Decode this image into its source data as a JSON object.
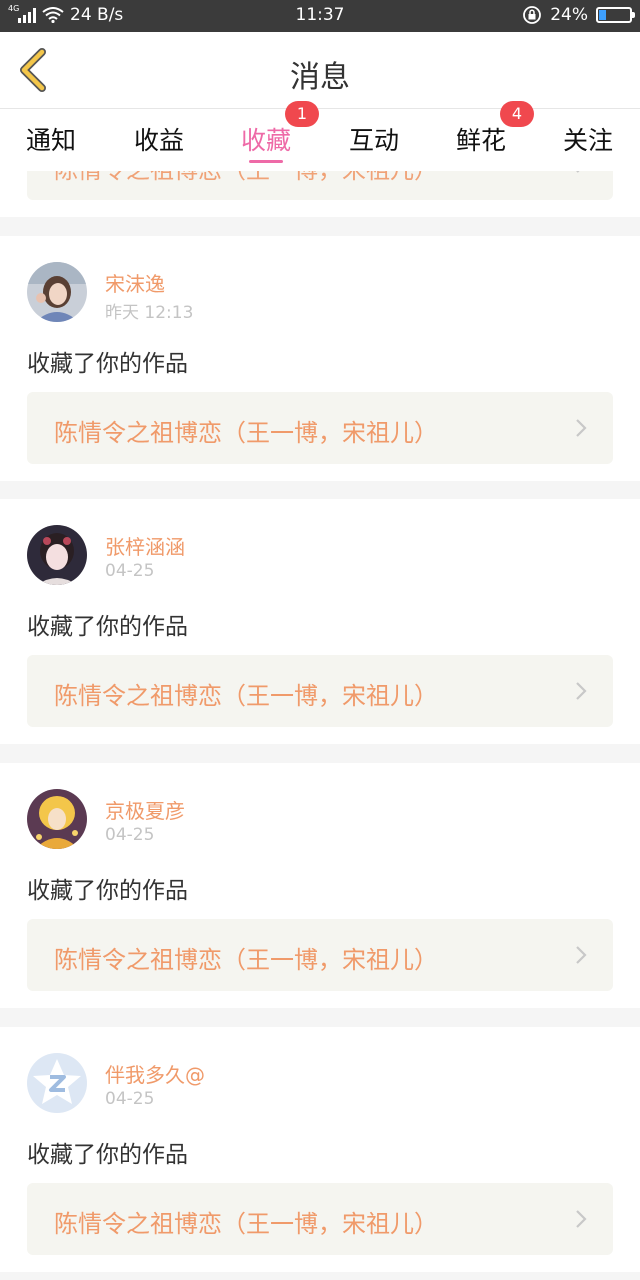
{
  "status_bar": {
    "network_tag": "4G",
    "speed": "24 B/s",
    "time": "11:37",
    "battery": "24%",
    "battery_level": 0.24
  },
  "header": {
    "title": "消息"
  },
  "tabs": [
    {
      "label": "通知"
    },
    {
      "label": "收益"
    },
    {
      "label": "收藏",
      "active": true,
      "badge": "1"
    },
    {
      "label": "互动"
    },
    {
      "label": "鲜花",
      "badge": "4"
    },
    {
      "label": "关注"
    }
  ],
  "partial_work_title": "陈情令之祖博恋（王一博，宋祖儿）",
  "items": [
    {
      "user": "宋沫逸",
      "time": "昨天 12:13",
      "action": "收藏了你的作品",
      "work": "陈情令之祖博恋（王一博，宋祖儿）"
    },
    {
      "user": "张梓涵涵",
      "time": "04-25",
      "action": "收藏了你的作品",
      "work": "陈情令之祖博恋（王一博，宋祖儿）"
    },
    {
      "user": "京极夏彦",
      "time": "04-25",
      "action": "收藏了你的作品",
      "work": "陈情令之祖博恋（王一博，宋祖儿）"
    },
    {
      "user": "伴我多久@",
      "time": "04-25",
      "action": "收藏了你的作品",
      "work": "陈情令之祖博恋（王一博，宋祖儿）"
    }
  ],
  "colors": {
    "accent_pink": "#ee6aa7",
    "badge_red": "#f0484e",
    "orange_text": "#f09a6a",
    "back_arrow": "#f3c64a"
  },
  "icons": [
    "back-arrow-icon",
    "chevron-right-icon",
    "signal-icon",
    "wifi-icon",
    "lock-rotation-icon",
    "battery-icon",
    "default-avatar-icon"
  ]
}
